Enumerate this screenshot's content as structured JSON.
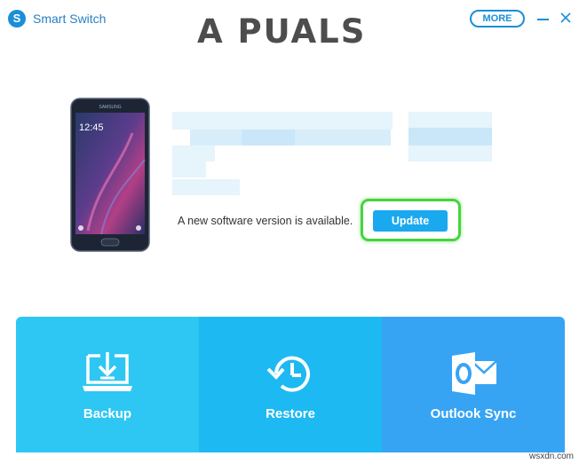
{
  "window": {
    "app_title": "Smart Switch",
    "app_logo_letter": "S",
    "more_label": "MORE",
    "watermark": "A PUALS"
  },
  "device": {
    "phone_brand": "SAMSUNG",
    "phone_clock": "12:45",
    "update_message": "A new software version is available.",
    "update_label": "Update"
  },
  "tiles": [
    {
      "label": "Backup",
      "icon": "laptop-download-icon"
    },
    {
      "label": "Restore",
      "icon": "clock-restore-icon"
    },
    {
      "label": "Outlook Sync",
      "icon": "outlook-icon"
    }
  ],
  "footer": {
    "url": "wsxdn.com"
  },
  "colors": {
    "accent": "#1a8fd8",
    "update_button": "#1aa9ef",
    "highlight": "#45d43c",
    "tile_backup": "#2ec7f3",
    "tile_restore": "#1db9f2",
    "tile_outlook": "#37a4f3"
  }
}
